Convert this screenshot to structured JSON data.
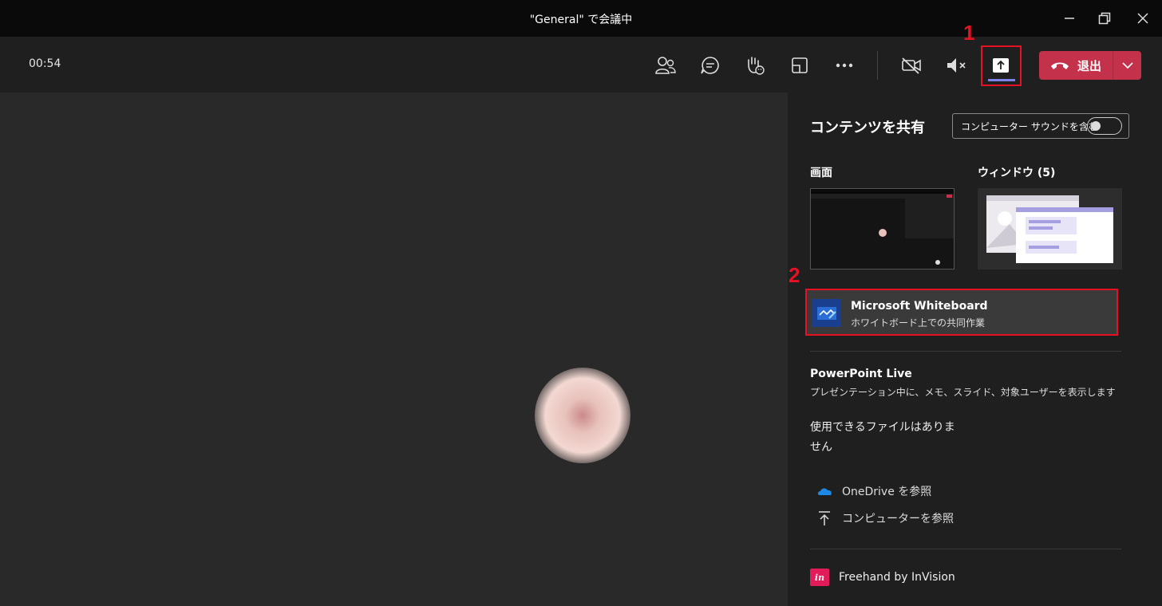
{
  "window": {
    "title": "\"General\" で会議中"
  },
  "toolbar": {
    "timer": "00:54",
    "leave_label": "退出",
    "icons": [
      "people-icon",
      "chat-icon",
      "raise-hand-icon",
      "rooms-icon",
      "more-icon",
      "camera-off-icon",
      "speaker-mute-icon",
      "share-tray-icon"
    ]
  },
  "callouts": {
    "one": "1",
    "two": "2"
  },
  "panel": {
    "title": "コンテンツを共有",
    "sound_toggle_label": "コンピューター サウンドを含む",
    "screen_label": "画面",
    "window_label": "ウィンドウ (5)",
    "whiteboard": {
      "name": "Microsoft Whiteboard",
      "subtitle": "ホワイトボード上での共同作業"
    },
    "powerpoint": {
      "title": "PowerPoint Live",
      "subtitle": "プレゼンテーション中に、メモ、スライド、対象ユーザーを表示します"
    },
    "no_files": "使用できるファイルはありません",
    "onedrive_label": "OneDrive を参照",
    "computer_label": "コンピューターを参照",
    "freehand_label": "Freehand by InVision",
    "freehand_icon_text": "in"
  },
  "colors": {
    "accent": "#7b83eb",
    "leave": "#c4314b",
    "callout": "#e81123",
    "onedrive": "#1e88e5"
  }
}
